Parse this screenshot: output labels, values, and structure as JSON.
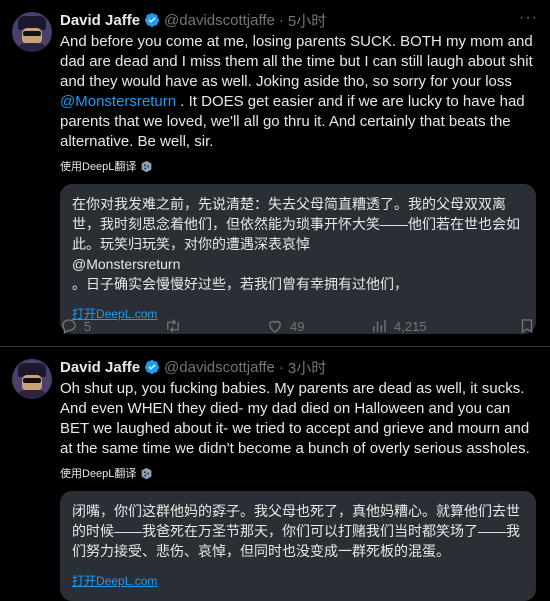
{
  "tweets": [
    {
      "name": "David Jaffe",
      "handle": "@davidscottjaffe",
      "time": "5小时",
      "text_before": "And before you come at me, losing parents SUCK. BOTH my mom and dad are dead and I miss them all the time but I can still laugh about shit and they would have as well. Joking aside tho, so sorry for your loss ",
      "mention": "@Monstersreturn",
      "text_after": " . It DOES get easier and if we are lucky to have had parents that we loved, we'll all go thru it. And certainly that beats the alternative. Be well, sir.",
      "translate_label": "使用DeepL翻译",
      "translation_lines": [
        "在你对我发难之前，先说清楚：失去父母简直糟透了。我的父母双双离",
        "世，我时刻思念着他们，但依然能为琐事开怀大笑——他们若在世也会如",
        "此。玩笑归玩笑，对你的遭遇深表哀悼",
        "@Monstersreturn",
        "。日子确实会慢慢好过些，若我们曾有幸拥有过他们，"
      ],
      "open_deepl": "打开DeepL.com",
      "replies": "5",
      "likes": "49",
      "views": "4,215"
    },
    {
      "name": "David Jaffe",
      "handle": "@davidscottjaffe",
      "time": "3小时",
      "text": "Oh shut up, you fucking babies. My parents are dead as well, it sucks. And even WHEN they died- my dad died on Halloween and you can BET we laughed about it- we tried to accept and grieve and mourn and at the same time we didn't become a bunch of overly serious assholes.",
      "translate_label": "使用DeepL翻译",
      "translation_lines": [
        "闭嘴，你们这群他妈的孬子。我父母也死了，真他妈糟心。就算他们去世",
        "的时候——我爸死在万圣节那天，你们可以打赌我们当时都笑场了——我",
        "们努力接受、悲伤、哀悼，但同时也没变成一群死板的混蛋。"
      ],
      "open_deepl": "打开DeepL.com"
    }
  ],
  "colors": {
    "accent": "#1d9bf0",
    "muted": "#71767b",
    "background": "#000000",
    "translation_box": "#2a2f35"
  }
}
